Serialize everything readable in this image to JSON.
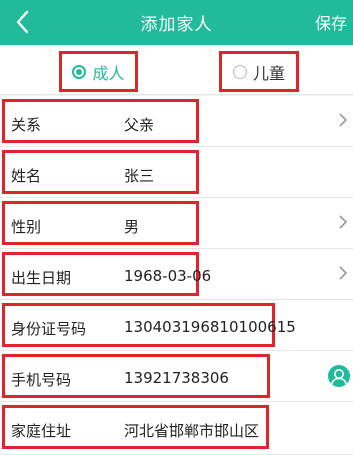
{
  "header": {
    "title": "添加家人",
    "save_label": "保存"
  },
  "type_selector": {
    "adult_label": "成人",
    "child_label": "儿童"
  },
  "fields": {
    "relation": {
      "label": "关系",
      "value": "父亲"
    },
    "name": {
      "label": "姓名",
      "value": "张三"
    },
    "gender": {
      "label": "性别",
      "value": "男"
    },
    "birthdate": {
      "label": "出生日期",
      "value": "1968-03-06"
    },
    "id_number": {
      "label": "身份证号码",
      "value": "130403196810100615"
    },
    "phone": {
      "label": "手机号码",
      "value": "13921738306"
    },
    "address": {
      "label": "家庭住址",
      "value": "河北省邯郸市邯山区"
    }
  },
  "colors": {
    "accent": "#21bb9c",
    "highlight_border": "#e0242b"
  },
  "icons": {
    "back": "chevron-left-icon",
    "row_arrow": "chevron-right-icon",
    "contacts": "contact-person-icon"
  }
}
